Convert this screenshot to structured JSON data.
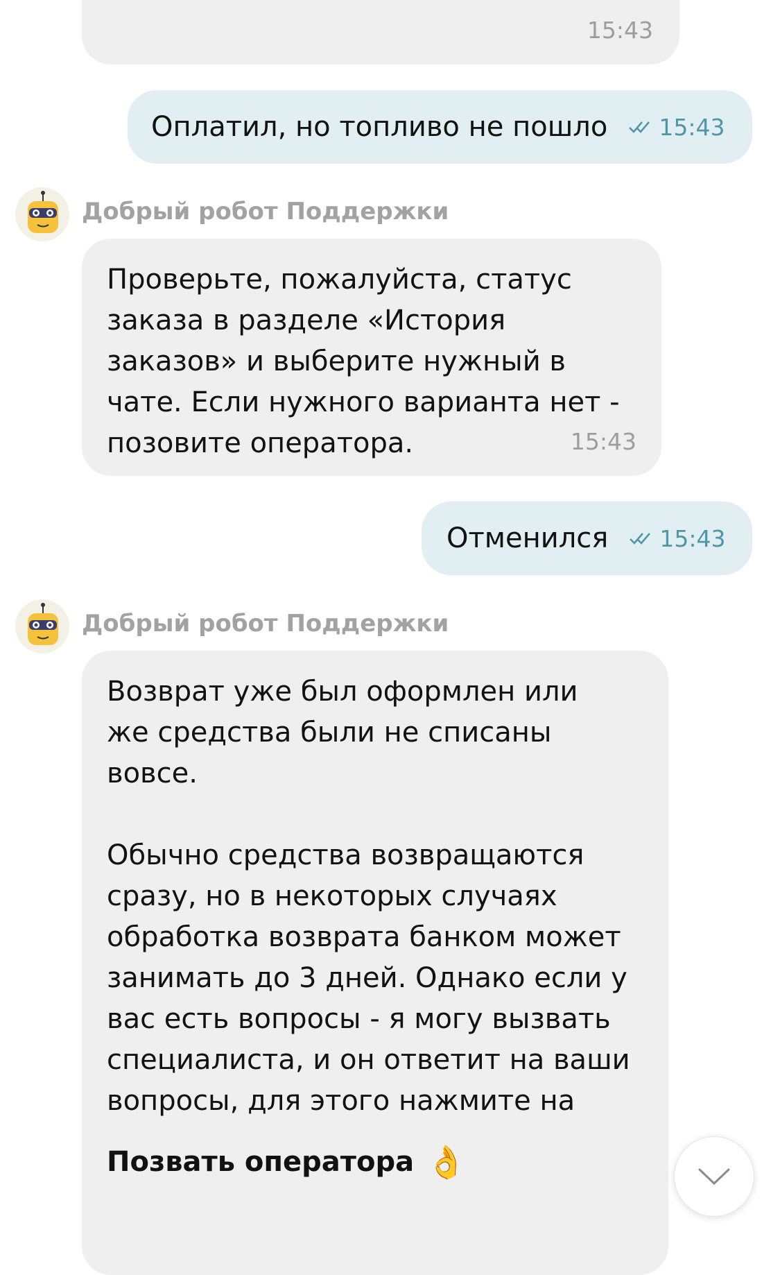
{
  "messages": [
    {
      "type": "incoming_partial",
      "time": "15:43"
    },
    {
      "type": "outgoing",
      "text": "Оплатил, но топливо не пошло",
      "time": "15:43"
    },
    {
      "type": "incoming",
      "sender": "Добрый робот Поддержки",
      "text": "Проверьте, пожалуйста, статус\nзаказа в разделе «История\nзаказов» и выберите нужный в\nчате. Если нужного варианта нет -\nпозовите оператора.",
      "time": "15:43"
    },
    {
      "type": "outgoing",
      "text": "Отменился",
      "time": "15:43"
    },
    {
      "type": "incoming",
      "sender": "Добрый робот Поддержки",
      "text_p1": "Возврат уже был оформлен или\nже средства были не списаны\nвовсе.",
      "text_p2": "Обычно средства возвращаются\nсразу, но в некоторых случаях\nобработка возврата банком может\nзанимать до 3 дней. Однако если у\nвас есть вопросы - я могу вызвать\nспециалиста, и он ответит на ваши\nвопросы, для этого нажмите на",
      "bold": "Позвать оператора",
      "emoji": "👌"
    }
  ],
  "icons": {
    "read_receipt": "double-check-icon",
    "scroll_down": "chevron-down-icon",
    "avatar": "robot-avatar-icon"
  },
  "colors": {
    "incoming_bg": "#efefef",
    "outgoing_bg": "#e1eff3",
    "outgoing_time": "#4f96a8"
  }
}
